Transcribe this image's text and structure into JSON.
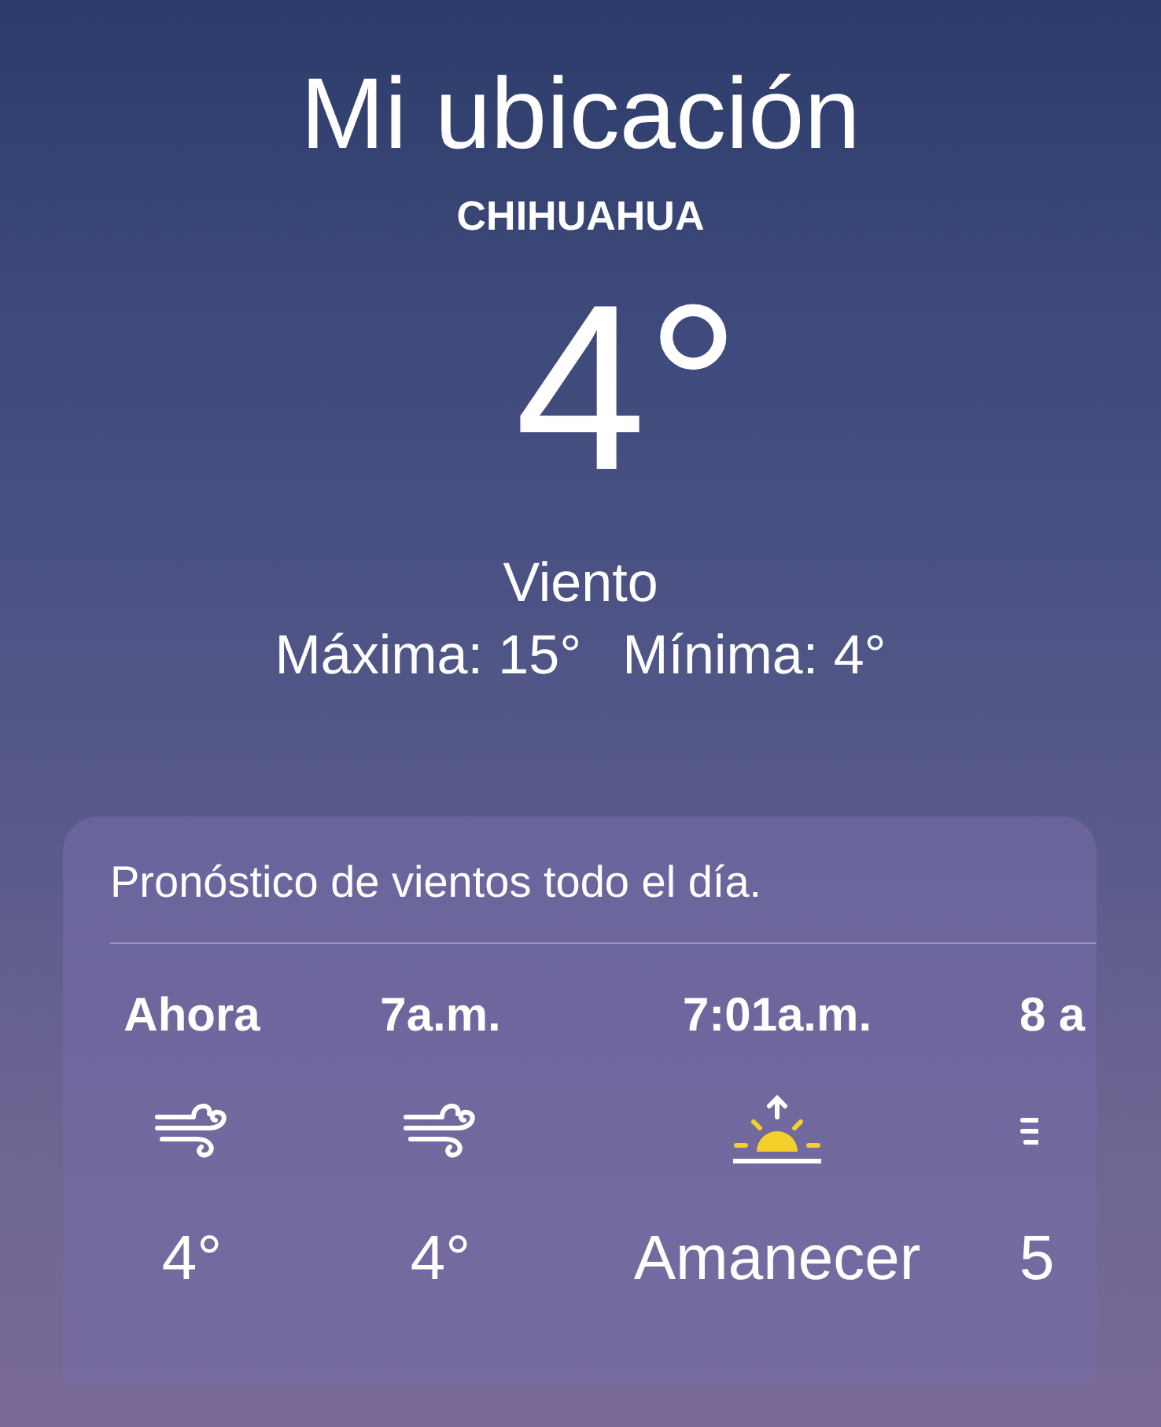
{
  "location": {
    "title": "Mi ubicación",
    "city": "CHIHUAHUA"
  },
  "current": {
    "temperature": "4°",
    "condition": "Viento",
    "high": "Máxima: 15°",
    "low": "Mínima: 4°"
  },
  "forecast": {
    "summary": "Pronóstico de vientos todo el día.",
    "hours": [
      {
        "kind": "wind",
        "time": "Ahora",
        "value": "4°"
      },
      {
        "kind": "wind",
        "time": "7a.m.",
        "value": "4°"
      },
      {
        "kind": "sunrise",
        "time": "7:01a.m.",
        "value": "Amanecer"
      },
      {
        "kind": "partial",
        "time": "8 a",
        "value": "5"
      }
    ]
  }
}
